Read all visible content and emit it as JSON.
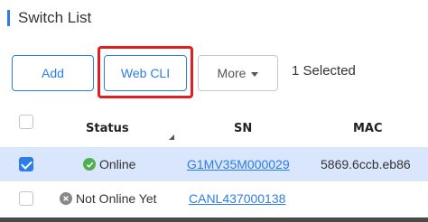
{
  "page": {
    "title": "Switch List"
  },
  "toolbar": {
    "add_label": "Add",
    "webcli_label": "Web CLI",
    "more_label": "More",
    "selected_text": "1 Selected"
  },
  "table": {
    "columns": [
      "Status",
      "SN",
      "MAC"
    ],
    "rows": [
      {
        "checked": true,
        "status": "Online",
        "sn": "G1MV35M000029",
        "mac": "5869.6ccb.eb86"
      },
      {
        "checked": false,
        "status": "Not Online Yet",
        "sn": "CANL437000138",
        "mac": ""
      }
    ]
  },
  "colors": {
    "accent": "#2b7de9",
    "highlight": "#e02020",
    "online": "#4caf50",
    "offline": "#888888",
    "selected_row": "#d9e6fb"
  },
  "icons": {
    "online": "check-circle-icon",
    "offline": "x-circle-icon",
    "more_caret": "caret-down-icon",
    "sort": "sort-indicator-icon"
  }
}
